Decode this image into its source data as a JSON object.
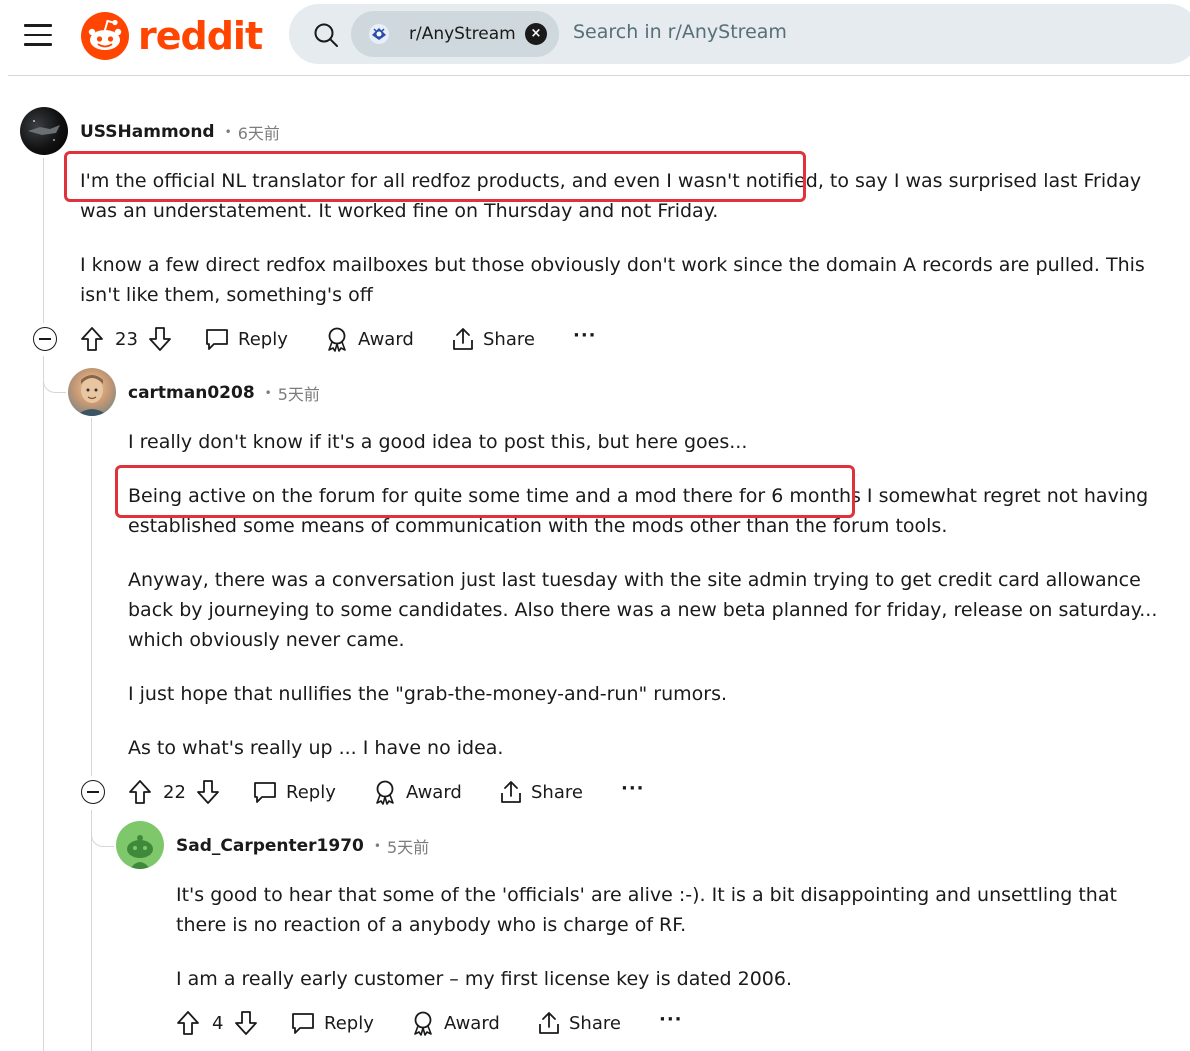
{
  "header": {
    "logo_text": "reddit",
    "search_chip": "r/AnyStream",
    "search_placeholder": "Search in r/AnyStream",
    "chip_close": "×"
  },
  "icons": [
    "menu-icon",
    "reddit-snoo-icon",
    "search-icon",
    "close-icon",
    "upvote-icon",
    "downvote-icon",
    "comment-icon",
    "award-icon",
    "share-icon",
    "more-icon",
    "collapse-icon"
  ],
  "colors": {
    "brand": "#ff4500",
    "highlight_box": "#e0323a",
    "search_bg": "#e5ebee"
  },
  "comments": [
    {
      "author": "USSHammond",
      "time": "6天前",
      "paragraphs": [
        "I'm the official NL translator for all redfoz products, and even I wasn't notified, to say I was surprised last Friday was an understatement. It worked fine on Thursday and not Friday.",
        "I know a few direct redfox mailboxes but those obviously don't work since the domain A records are pulled. This isn't like them, something's off"
      ],
      "votes": "23",
      "actions": {
        "reply": "Reply",
        "award": "Award",
        "share": "Share",
        "more": "···"
      }
    },
    {
      "author": "cartman0208",
      "time": "5天前",
      "paragraphs": [
        "I really don't know if it's a good idea to post this, but here goes...",
        "Being active on the forum for quite some time and a mod there for 6 months I somewhat regret not having established some means of communication with the mods other than the forum tools.",
        "Anyway, there was a conversation just last tuesday with the site admin trying to get credit card allowance back by journeying to some candidates. Also there was a new beta planned for friday, release on saturday... which obviously never came.",
        "I just hope that nullifies the \"grab-the-money-and-run\" rumors.",
        "As to what's really up ... I have no idea."
      ],
      "votes": "22",
      "actions": {
        "reply": "Reply",
        "award": "Award",
        "share": "Share",
        "more": "···"
      }
    },
    {
      "author": "Sad_Carpenter1970",
      "time": "5天前",
      "paragraphs": [
        "It's good to hear that some of the 'officials' are alive :-). It is a bit disappointing and unsettling that there is no reaction of a anybody who is charge of RF.",
        "I am a really early customer – my first license key is dated 2006."
      ],
      "votes": "4",
      "actions": {
        "reply": "Reply",
        "award": "Award",
        "share": "Share",
        "more": "···"
      }
    }
  ]
}
